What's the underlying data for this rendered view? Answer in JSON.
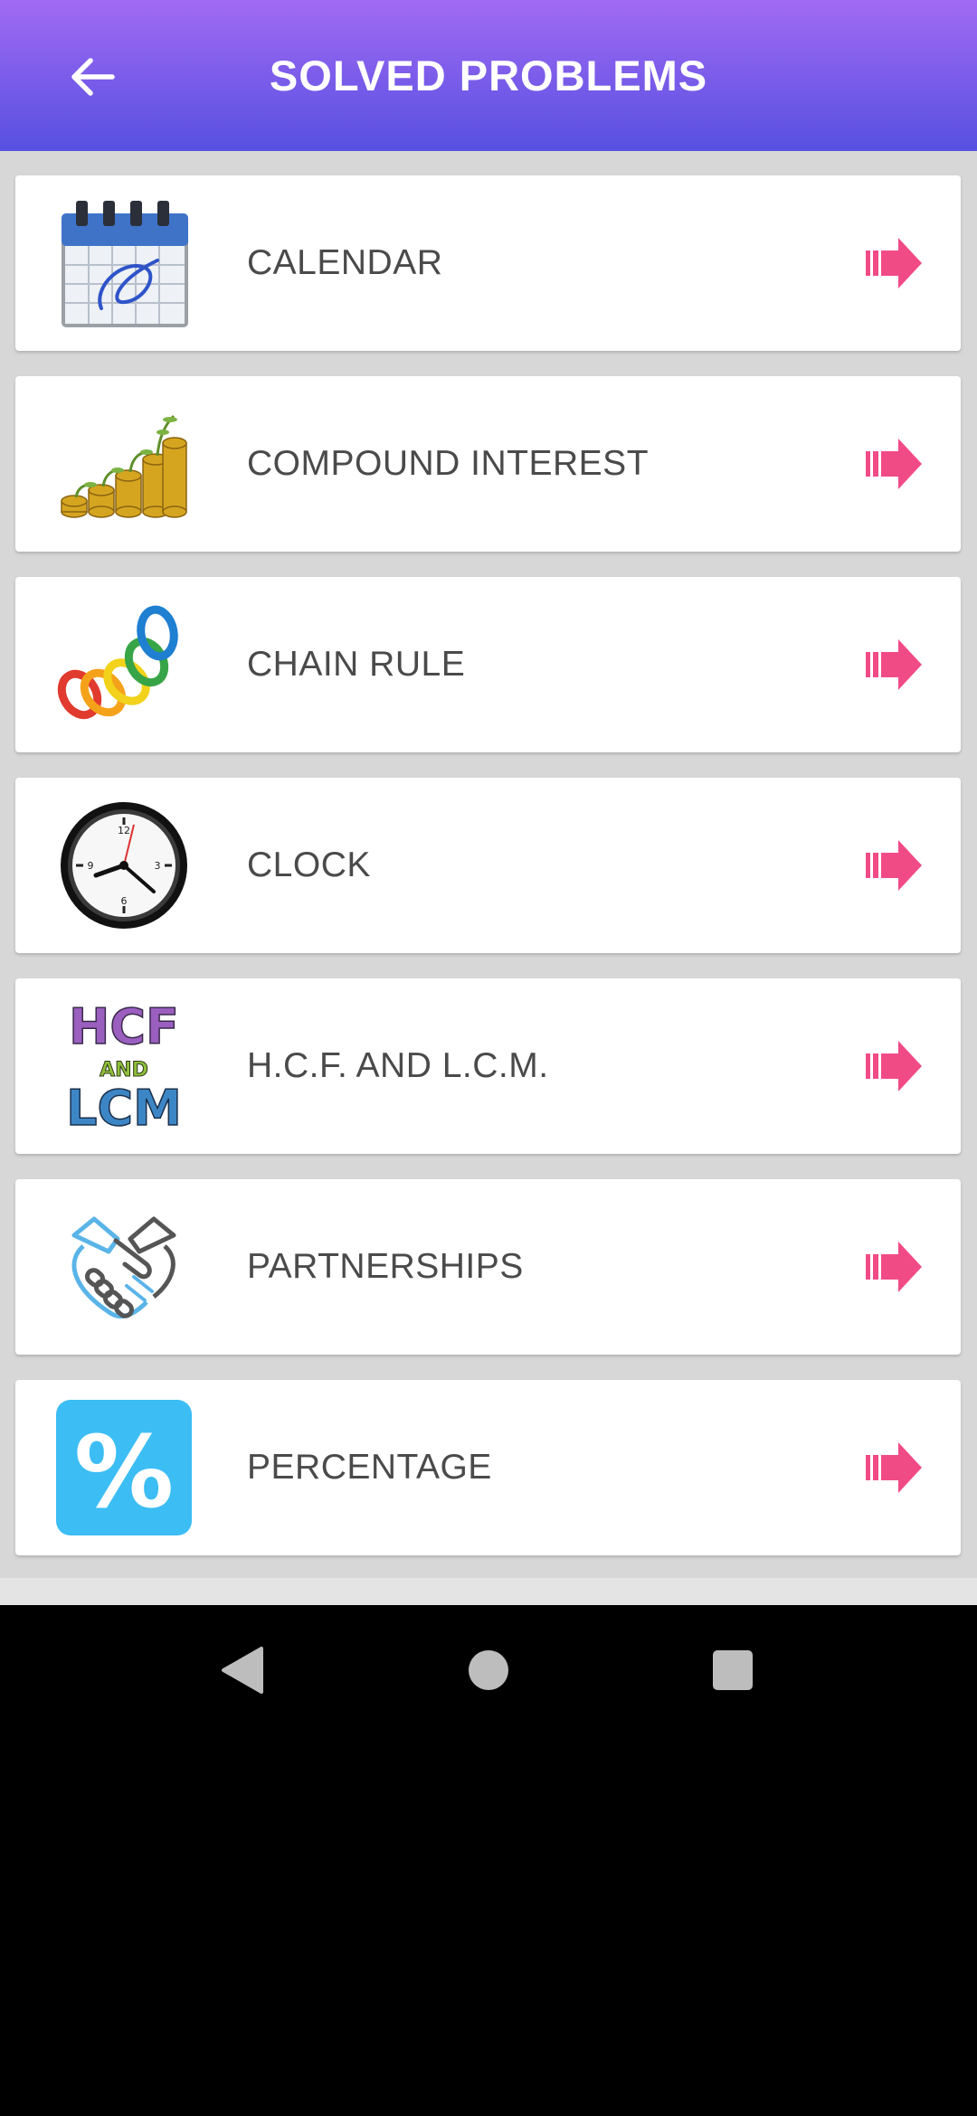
{
  "header": {
    "title": "SOLVED PROBLEMS",
    "back_icon": "arrow-left-icon"
  },
  "topics": [
    {
      "label": "CALENDAR",
      "icon": "calendar-icon"
    },
    {
      "label": "COMPOUND INTEREST",
      "icon": "coins-growth-icon"
    },
    {
      "label": "CHAIN RULE",
      "icon": "chain-links-icon"
    },
    {
      "label": "CLOCK",
      "icon": "clock-icon"
    },
    {
      "label": "H.C.F. AND L.C.M.",
      "icon": "hcf-lcm-icon",
      "icon_text": {
        "top": "HCF",
        "middle": "AND",
        "bottom": "LCM"
      }
    },
    {
      "label": "PARTNERSHIPS",
      "icon": "handshake-icon"
    },
    {
      "label": "PERCENTAGE",
      "icon": "percent-icon",
      "icon_text": "%"
    }
  ],
  "row_arrow_icon": "pink-arrow-right-icon",
  "system_nav": {
    "back": "nav-back-icon",
    "home": "nav-home-icon",
    "recents": "nav-recents-icon"
  },
  "colors": {
    "header_gradient_top": "#a16af3",
    "header_gradient_bottom": "#5750e1",
    "arrow": "#f14b86",
    "label_text": "#4a4a4a",
    "list_background": "#d7d7d7"
  }
}
